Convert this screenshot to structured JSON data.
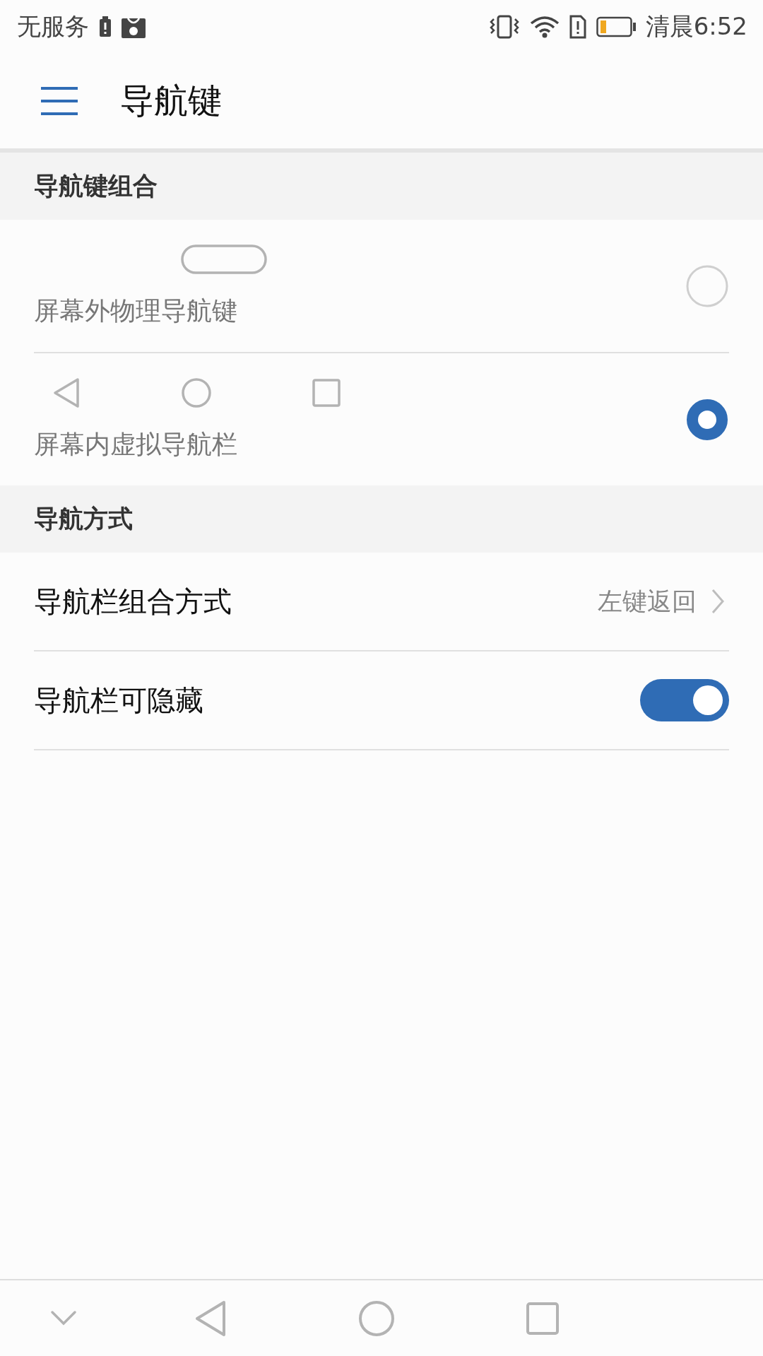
{
  "status_bar": {
    "carrier": "无服务",
    "time": "清晨6:52"
  },
  "app_bar": {
    "title": "导航键"
  },
  "sections": [
    {
      "header": "导航键组合",
      "kind": "options",
      "options": [
        {
          "kind": "physical",
          "label": "屏幕外物理导航键",
          "selected": false
        },
        {
          "kind": "virtual",
          "label": "屏幕内虚拟导航栏",
          "selected": true
        }
      ]
    },
    {
      "header": "导航方式",
      "kind": "settings",
      "items": [
        {
          "kind": "link",
          "label": "导航栏组合方式",
          "value": "左键返回"
        },
        {
          "kind": "switch",
          "label": "导航栏可隐藏",
          "on": true
        }
      ]
    }
  ]
}
